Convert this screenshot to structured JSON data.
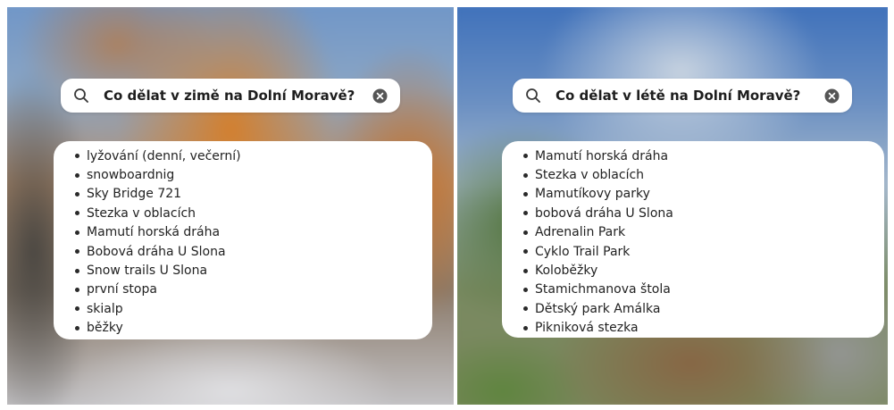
{
  "panels": {
    "winter": {
      "query": "Co dělat v zimě na Dolní Moravě?",
      "search_icon": "search-icon",
      "clear_icon": "clear-icon",
      "items": [
        "lyžování (denní, večerní)",
        "snowboardnig",
        "Sky Bridge 721",
        "Stezka v oblacích",
        "Mamutí horská dráha",
        "Bobová dráha U Slona",
        "Snow trails U Slona",
        "první stopa",
        "skialp",
        "běžky"
      ]
    },
    "summer": {
      "query": "Co dělat v létě na Dolní Moravě?",
      "search_icon": "search-icon",
      "clear_icon": "clear-icon",
      "items": [
        "Mamutí horská dráha",
        "Stezka v oblacích",
        "Mamutíkovy parky",
        "bobová dráha U Slona",
        "Adrenalin Park",
        "Cyklo Trail Park",
        "Koloběžky",
        "Stamichmanova štola",
        "Dětský park Amálka",
        "Pikniková stezka"
      ]
    }
  },
  "colors": {
    "search_text": "#1e1e1e",
    "item_text": "#222222",
    "icon": "#3a3a3a",
    "clear_badge": "#555555",
    "card_bg": "#ffffff"
  }
}
